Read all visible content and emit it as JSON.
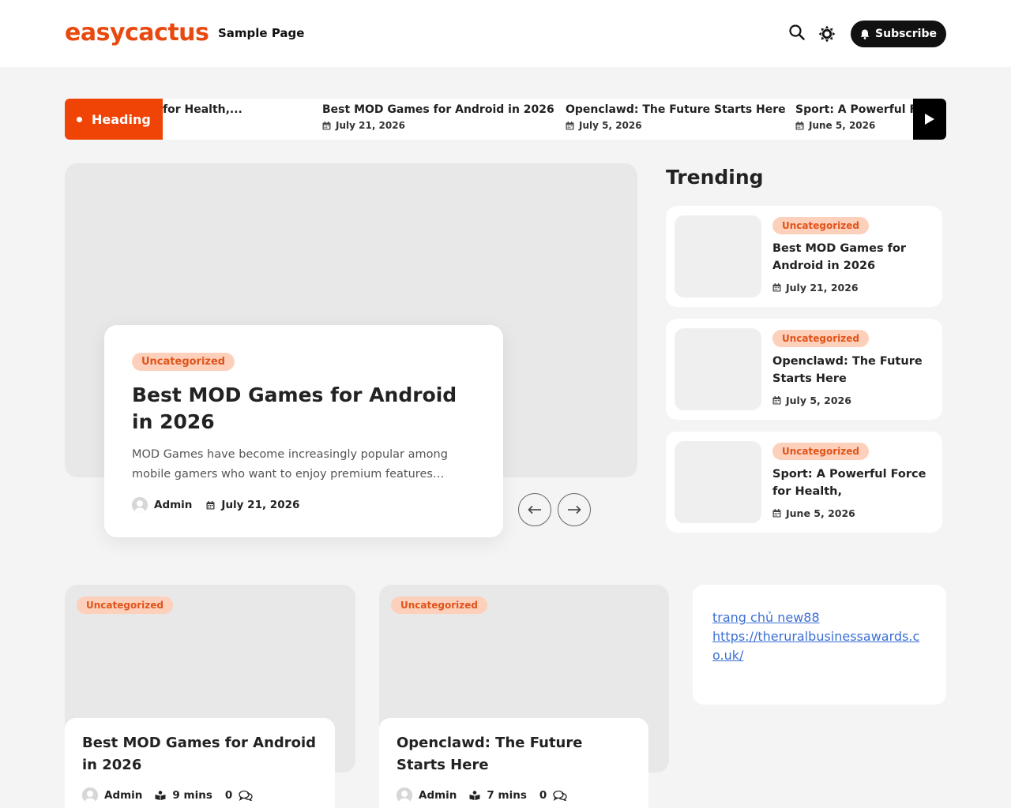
{
  "header": {
    "logo": "easycactus",
    "nav": [
      "Sample Page"
    ],
    "subscribe_label": "Subscribe"
  },
  "ticker": {
    "label": "Heading",
    "items": [
      {
        "title": "for Health,...",
        "date": ""
      },
      {
        "title": "Best MOD Games for Android in 2026",
        "date": "July 21, 2026"
      },
      {
        "title": "Openclawd: The Future Starts Here",
        "date": "July 5, 2026"
      },
      {
        "title": "Sport: A Powerful F",
        "date": "June 5, 2026"
      }
    ]
  },
  "hero": {
    "category": "Uncategorized",
    "title": "Best MOD Games for Android in 2026",
    "excerpt": "MOD Games have become increasingly popular among mobile gamers who want to enjoy premium features…",
    "author": "Admin",
    "date": "July 21, 2026"
  },
  "trending": {
    "heading": "Trending",
    "items": [
      {
        "category": "Uncategorized",
        "title": "Best MOD Games for Android in 2026",
        "date": "July 21, 2026"
      },
      {
        "category": "Uncategorized",
        "title": "Openclawd: The Future Starts Here",
        "date": "July 5, 2026"
      },
      {
        "category": "Uncategorized",
        "title": "Sport: A Powerful Force for Health, Competition,...",
        "date": "June 5, 2026"
      }
    ]
  },
  "posts": [
    {
      "category": "Uncategorized",
      "title": "Best MOD Games for Android in 2026",
      "author": "Admin",
      "read_time": "9 mins",
      "comments": "0"
    },
    {
      "category": "Uncategorized",
      "title": "Openclawd: The Future Starts Here",
      "author": "Admin",
      "read_time": "7 mins",
      "comments": "0"
    }
  ],
  "widget": {
    "links": [
      "trang chủ new88",
      "https://theruralbusinessawards.co.uk/"
    ]
  },
  "colors": {
    "accent": "#f04406",
    "logo": "#e8490f",
    "badge_bg": "#fdd0bb",
    "badge_text": "#e0531a",
    "link": "#3b6fd6"
  },
  "icons": [
    "search-icon",
    "sun-icon",
    "bell-icon",
    "calendar-icon",
    "play-icon",
    "arrow-left-icon",
    "arrow-right-icon",
    "user-icon",
    "book-icon",
    "comment-icon"
  ]
}
